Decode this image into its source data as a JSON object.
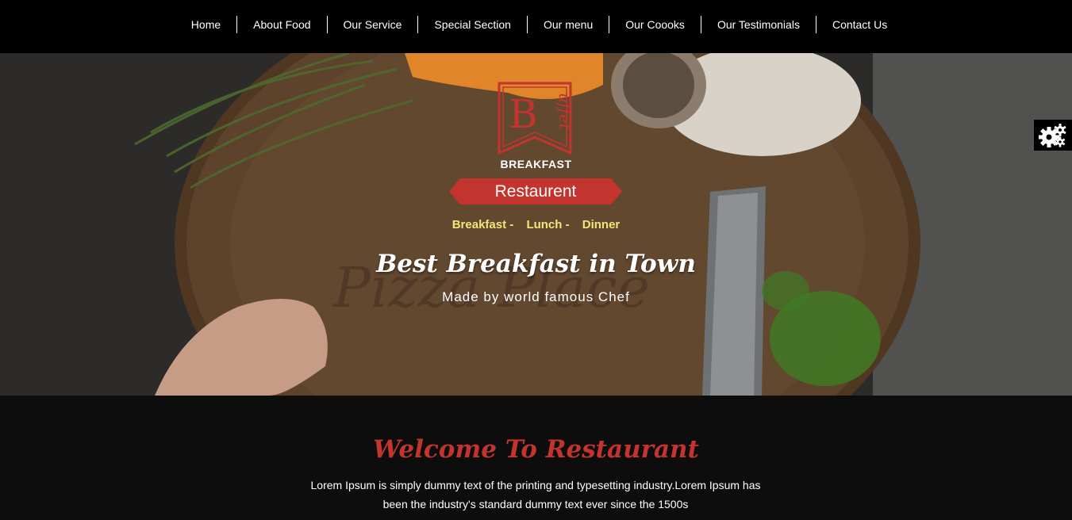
{
  "nav": {
    "items": [
      {
        "label": "Home"
      },
      {
        "label": "About Food"
      },
      {
        "label": "Our Service"
      },
      {
        "label": "Special Section"
      },
      {
        "label": "Our menu"
      },
      {
        "label": "Our Coooks"
      },
      {
        "label": "Our Testimonials"
      },
      {
        "label": "Contact Us"
      }
    ]
  },
  "hero": {
    "logo_icon": "buffet-logo-icon",
    "logo_letters": "B",
    "logo_script": "uffet",
    "brand_word": "BREAKFAST",
    "ribbon_label": "Restaurent",
    "meals": [
      "Breakfast -",
      "Lunch -",
      "Dinner"
    ],
    "title": "Best Breakfast in Town",
    "subtitle": "Made by world famous Chef"
  },
  "settings": {
    "icon": "gears-icon"
  },
  "welcome": {
    "title": "Welcome To Restaurant",
    "text": "Lorem Ipsum is simply dummy text of the printing and typesetting industry.Lorem Ipsum has been the industry's standard dummy text ever since the 1500s"
  },
  "colors": {
    "accent_red": "#c2342d",
    "meal_yellow": "#f3e57a",
    "nav_bg": "#000000"
  }
}
